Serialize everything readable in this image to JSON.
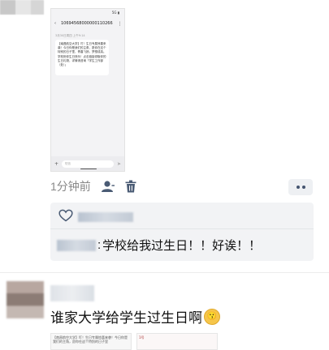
{
  "post1": {
    "phone": {
      "status_time": "",
      "status_icons": "5G ▮",
      "back_glyph": "‹",
      "sender_number": "10694568000000110266",
      "menu_glyph": "⋮",
      "date_line": "3月30日周四 上午9:14",
      "message": "【南昌航空大学】叮！生日专属惊喜来袭！今日你是我们的主角，愿你在这个特别的日子里，青春飞扬，梦想成真。学校祝你生日快乐！点击链接领取你的生日礼物，详情请咨询「学生工作部（处）」",
      "input_placeholder": "短信",
      "plus_glyph": "+",
      "send_glyph": "➤"
    },
    "time_ago": "1分钟前",
    "comment_separator": ":",
    "comment_text": "学校给我过生日！！好诶！！"
  },
  "post2": {
    "text": "谁家大学给学生过生日啊",
    "emoji": "😗",
    "thumb1_text": "【南昌航空大学】叮！生日专属惊喜来袭！今日你是我们的主角，愿你在这个特别的日子里",
    "thumb2_text": "1号"
  }
}
